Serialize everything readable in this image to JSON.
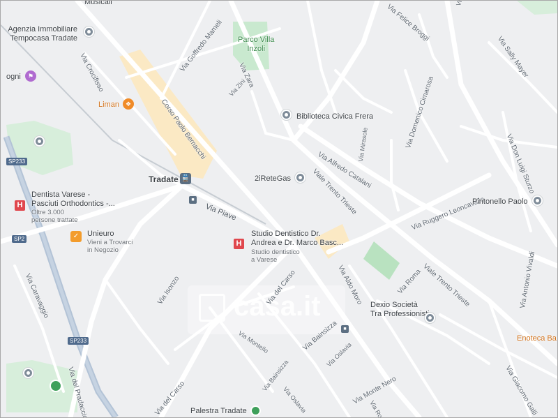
{
  "map": {
    "roads": [
      "Via Goffredo Mameli",
      "Via Zara",
      "Via Zini",
      "Via Crocifisso",
      "Corso Paolo Bernacchi",
      "Via Mirasole",
      "Via Alfredo Catalani",
      "Viale Trento Trieste",
      "Viale Trento Trieste",
      "Via Domenico Cimarosa",
      "Via Felice Broggi",
      "Via Sally Mayer",
      "Via Don Luigi Sturzo",
      "Via Ruggero Leoncavallo",
      "Via Antonio Vivaldi",
      "Via Piave",
      "Via Isonzo",
      "Via del Carso",
      "Via Aldo Moro",
      "Via Roma",
      "Via Bainsizza",
      "Via Bainsizza",
      "Via Montello",
      "Via Oslavia",
      "Via Oslavia",
      "Via Monte Nero",
      "Via Rovereto",
      "Via Giacomo Galli",
      "Via Caravaggio",
      "Via del Carso",
      "Via del Pradaccio",
      "Via Felice"
    ],
    "shields": [
      "SP233",
      "SP2",
      "SP233"
    ],
    "places": {
      "agenzia": "Agenzia Immobiliare\nTempocasa Tradate",
      "musicali": "Musicali",
      "parco": "Parco Villa\nInzoli",
      "biblioteca": "Biblioteca Civica Frera",
      "liman": "Liman",
      "comune": "ogni",
      "tradate": "Tradate",
      "zirete": "2iReteGas",
      "pintonello": "Pintonello Paolo",
      "dentista_title": "Dentista Varese -\nPasciuti Orthodontics -...",
      "dentista_sub": "Oltre 3.000\npersone trattate",
      "unieuro_title": "Unieuro",
      "unieuro_sub": "Vieni a Trovarci\nin Negozio",
      "studio_title": "Studio Dentistico Dr.\nAndrea e Dr. Marco Basc...",
      "studio_sub": "Studio dentistico\na Varese",
      "dexio": "Dexio Società\nTra Professionisti",
      "enoteca": "Enoteca Ba",
      "palestra": "Palestra Tradate"
    },
    "watermark": "casa.it",
    "colors": {
      "background": "#eeeff1",
      "road": "#ffffff",
      "major_road": "#b3c3d6",
      "park": "#c9e9cf",
      "pedestrian": "#fbe9c4",
      "poi_gray": "#7f8c99",
      "hospital": "#e0474d",
      "food": "#f08b28",
      "transit": "#5c6f82"
    }
  }
}
